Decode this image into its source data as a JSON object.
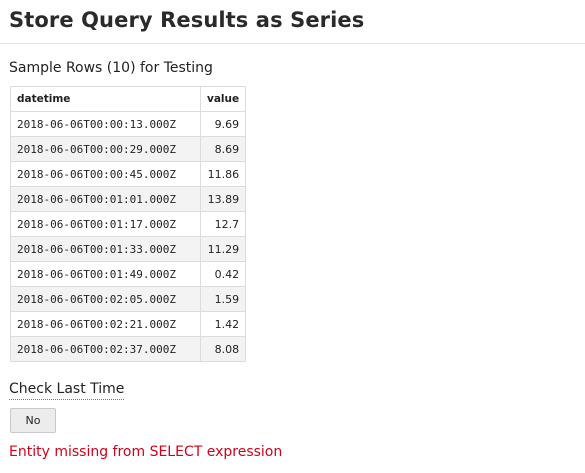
{
  "page": {
    "title": "Store Query Results as Series"
  },
  "sample": {
    "heading": "Sample Rows (10) for Testing",
    "columns": [
      "datetime",
      "value"
    ],
    "rows": [
      [
        "2018-06-06T00:00:13.000Z",
        "9.69"
      ],
      [
        "2018-06-06T00:00:29.000Z",
        "8.69"
      ],
      [
        "2018-06-06T00:00:45.000Z",
        "11.86"
      ],
      [
        "2018-06-06T00:01:01.000Z",
        "13.89"
      ],
      [
        "2018-06-06T00:01:17.000Z",
        "12.7"
      ],
      [
        "2018-06-06T00:01:33.000Z",
        "11.29"
      ],
      [
        "2018-06-06T00:01:49.000Z",
        "0.42"
      ],
      [
        "2018-06-06T00:02:05.000Z",
        "1.59"
      ],
      [
        "2018-06-06T00:02:21.000Z",
        "1.42"
      ],
      [
        "2018-06-06T00:02:37.000Z",
        "8.08"
      ]
    ]
  },
  "check_last_time": {
    "label": "Check Last Time",
    "value": "No"
  },
  "error": {
    "message": "Entity missing from SELECT expression",
    "color": "#d0021b"
  }
}
